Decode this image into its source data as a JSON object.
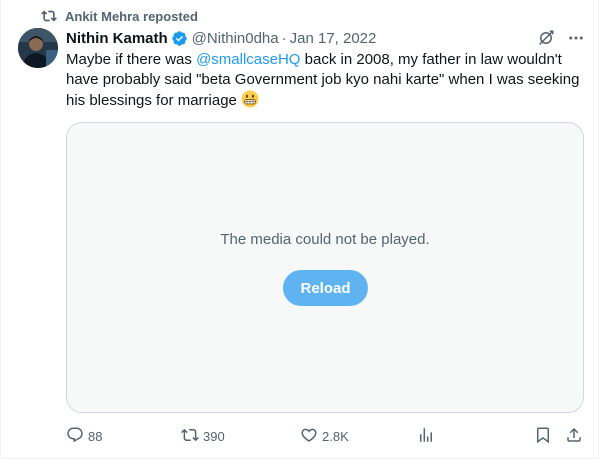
{
  "repost": {
    "text": "Ankit Mehra reposted",
    "icon": "repost-icon"
  },
  "author": {
    "name": "Nithin Kamath",
    "handle": "@Nithin0dha",
    "separator": "·",
    "date": "Jan 17, 2022",
    "verified": true
  },
  "tweet": {
    "before": "Maybe if there was ",
    "mention": "@smallcaseHQ",
    "after": " back in 2008,  my father in law wouldn't have probably said \"beta Government job kyo nahi karte\" when I was seeking his blessings for marriage ",
    "emoji": "grimacing-face-emoji"
  },
  "media": {
    "message": "The media could not be played.",
    "reload_label": "Reload"
  },
  "actions": {
    "replies": "88",
    "reposts": "390",
    "likes": "2.8K"
  },
  "colors": {
    "accent": "#1d9bf0",
    "muted": "#536471",
    "reload_bg": "#5fb3f0"
  }
}
